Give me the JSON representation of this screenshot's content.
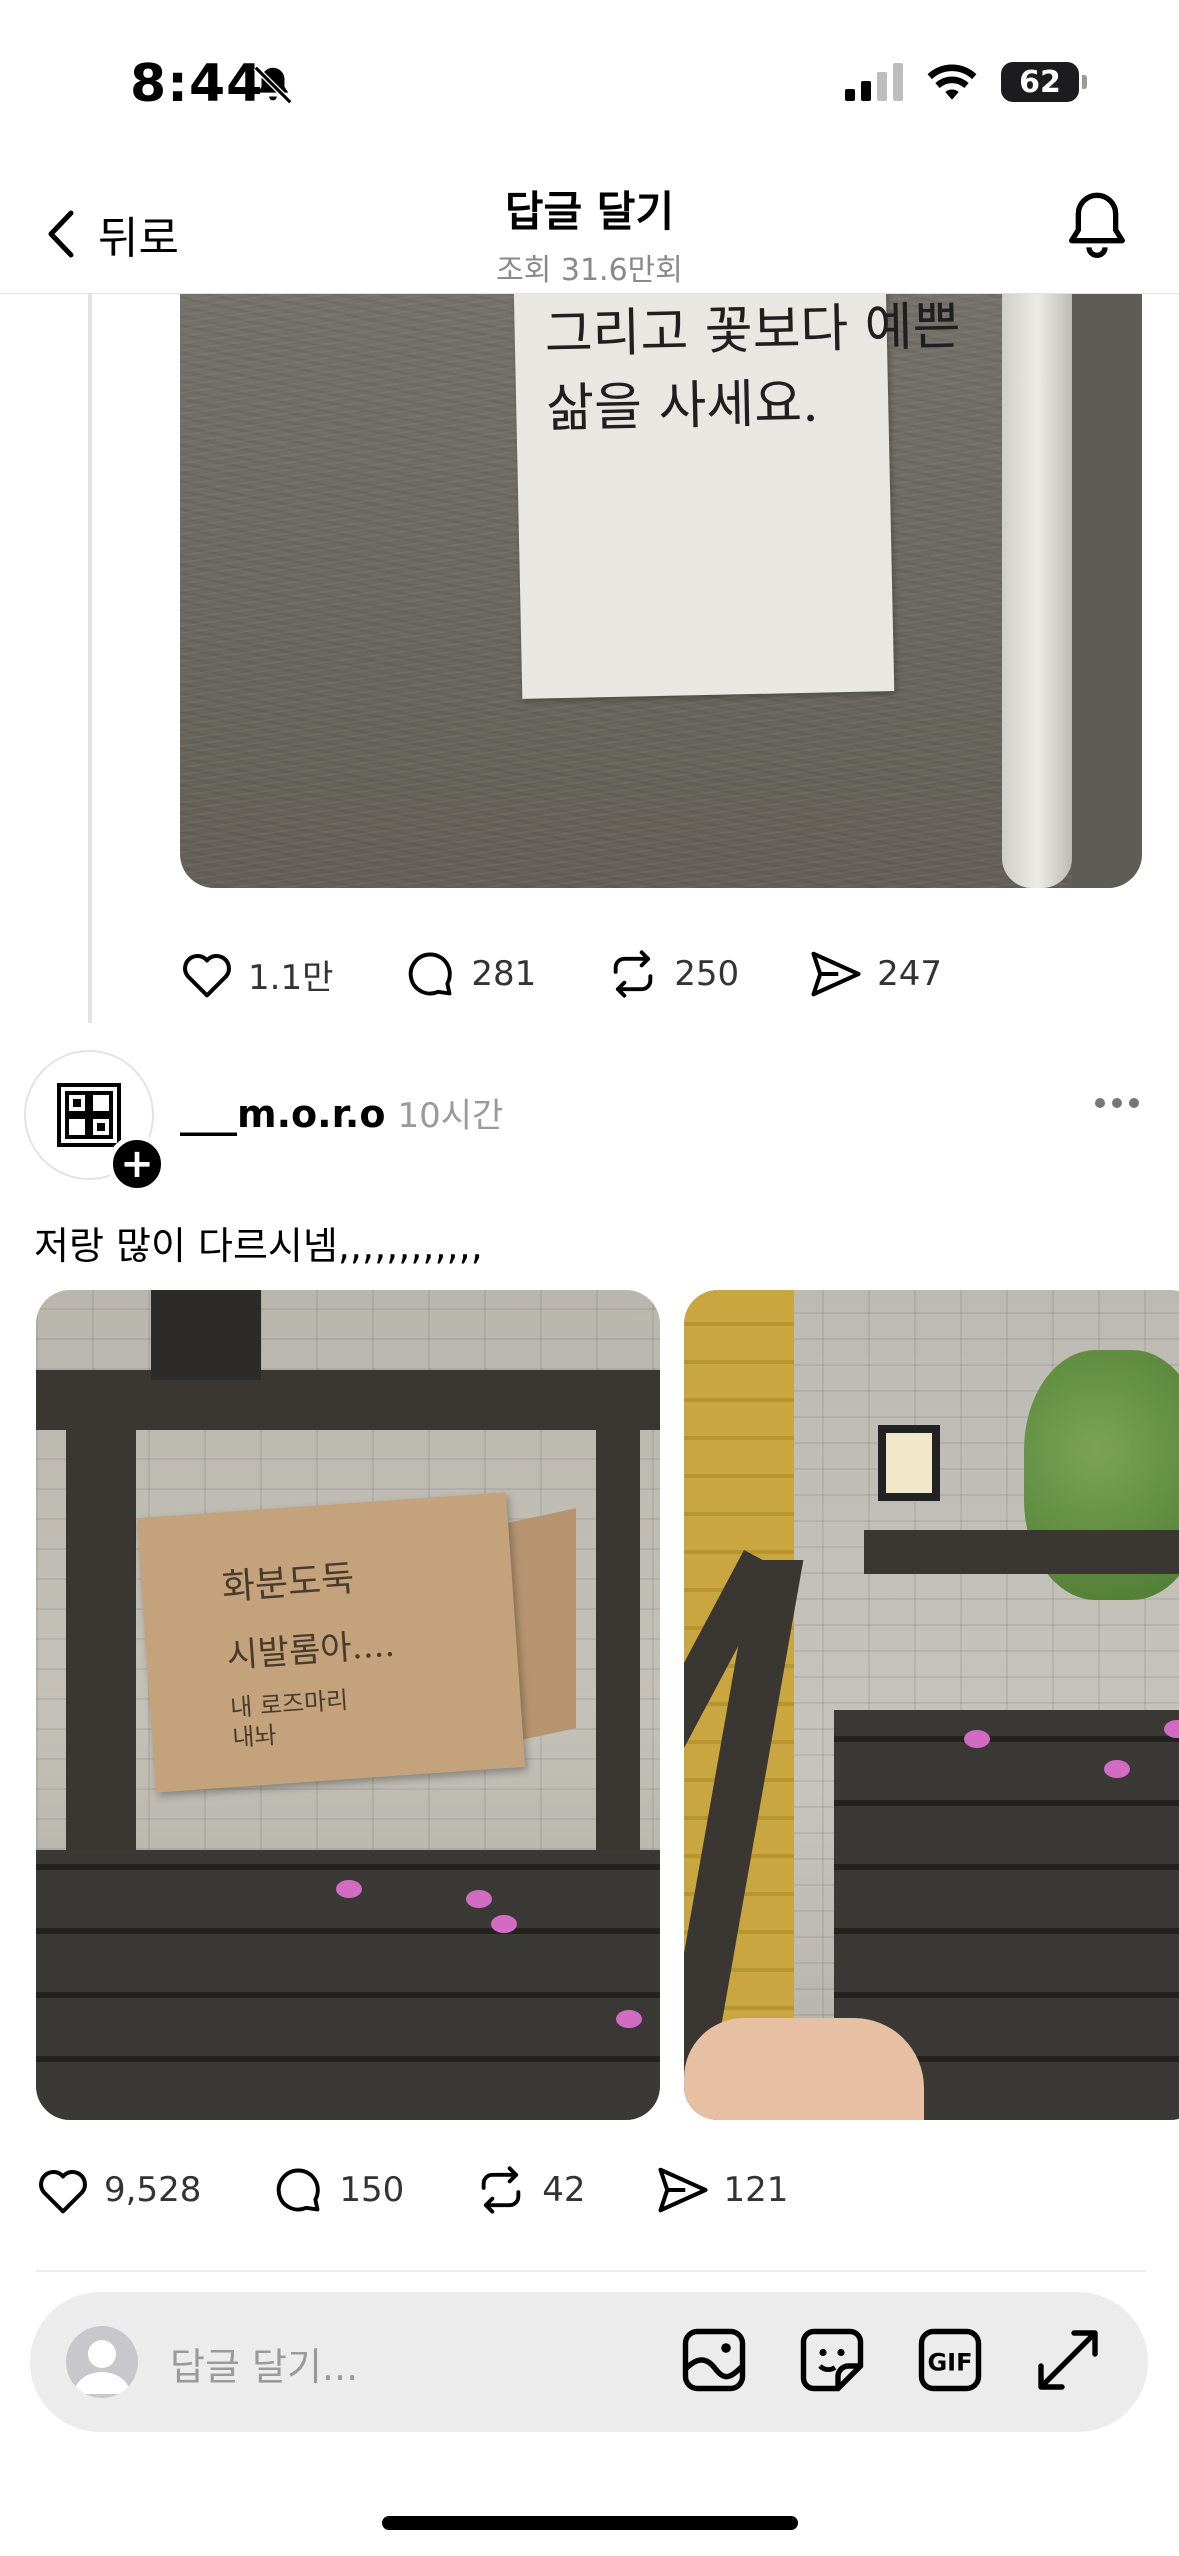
{
  "status_bar": {
    "time": "8:44",
    "battery": "62",
    "icons": [
      "bell-slash-icon",
      "signal-icon",
      "wifi-icon",
      "battery-icon"
    ]
  },
  "header": {
    "back_label": "뒤로",
    "title": "답글 달기",
    "subtitle": "조회 31.6만회",
    "icons": [
      "chevron-left-icon",
      "bell-icon"
    ]
  },
  "post1": {
    "image_text": [
      "그리고 꽃보다 예쁜",
      "삶을 사세요."
    ],
    "actions": {
      "likes": "1.1만",
      "comments": "281",
      "reposts": "250",
      "shares": "247"
    }
  },
  "post2": {
    "username": "___m.o.r.o",
    "time": "10시간",
    "text": "저랑 많이 다르시넴,,,,,,,,,,,,",
    "photo_a_text": [
      "화분도둑",
      "시발롬아....",
      "내 로즈마리",
      "내놔"
    ],
    "actions": {
      "likes": "9,528",
      "comments": "150",
      "reposts": "42",
      "shares": "121"
    }
  },
  "reply_bar": {
    "placeholder": "답글 달기...",
    "tools": [
      "image-icon",
      "sticker-icon",
      "gif-icon",
      "expand-icon"
    ],
    "gif_label": "GIF"
  }
}
